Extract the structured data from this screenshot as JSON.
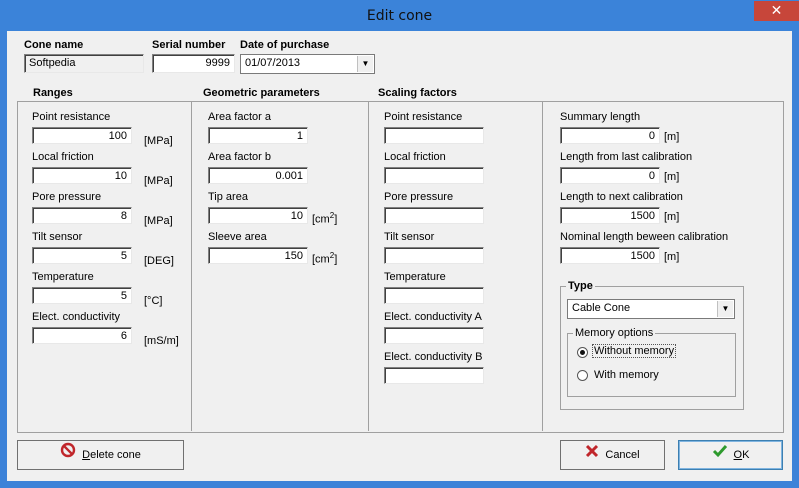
{
  "window": {
    "title": "Edit cone",
    "close_glyph": "✕"
  },
  "header": {
    "cone_name_label": "Cone name",
    "cone_name_value": "Softpedia",
    "serial_number_label": "Serial number",
    "serial_number_value": "9999",
    "date_of_purchase_label": "Date of purchase",
    "date_of_purchase_value": "01/07/2013"
  },
  "ranges": {
    "title": "Ranges",
    "items": [
      {
        "label": "Point resistance",
        "value": "100",
        "unit": "[MPa]"
      },
      {
        "label": "Local friction",
        "value": "10",
        "unit": "[MPa]"
      },
      {
        "label": "Pore pressure",
        "value": "8",
        "unit": "[MPa]"
      },
      {
        "label": "Tilt sensor",
        "value": "5",
        "unit": "[DEG]"
      },
      {
        "label": "Temperature",
        "value": "5",
        "unit": "[°C]"
      },
      {
        "label": "Elect. conductivity",
        "value": "6",
        "unit": "[mS/m]"
      }
    ]
  },
  "geometric": {
    "title": "Geometric parameters",
    "items": [
      {
        "label": "Area factor a",
        "value": "1",
        "unit": ""
      },
      {
        "label": "Area factor b",
        "value": "0.001",
        "unit": ""
      },
      {
        "label": "Tip area",
        "value": "10",
        "unit": "[cm",
        "unit_sup": "2",
        "unit_end": "]"
      },
      {
        "label": "Sleeve area",
        "value": "150",
        "unit": "[cm",
        "unit_sup": "2",
        "unit_end": "]"
      }
    ]
  },
  "scaling": {
    "title": "Scaling factors",
    "items": [
      {
        "label": "Point resistance",
        "value": ""
      },
      {
        "label": "Local friction",
        "value": ""
      },
      {
        "label": "Pore pressure",
        "value": ""
      },
      {
        "label": "Tilt sensor",
        "value": ""
      },
      {
        "label": "Temperature",
        "value": ""
      },
      {
        "label": "Elect. conductivity A",
        "value": ""
      },
      {
        "label": "Elect. conductivity B",
        "value": ""
      }
    ]
  },
  "lengths": {
    "items": [
      {
        "label": "Summary length",
        "value": "0",
        "unit": "[m]"
      },
      {
        "label": "Length from last calibration",
        "value": "0",
        "unit": "[m]"
      },
      {
        "label": "Length to next calibration",
        "value": "1500",
        "unit": "[m]"
      },
      {
        "label": "Nominal length beween calibration",
        "value": "1500",
        "unit": "[m]"
      }
    ]
  },
  "type": {
    "title": "Type",
    "selected": "Cable Cone",
    "memory_options_title": "Memory options",
    "option_without": "Without memory",
    "option_with": "With memory",
    "selected_option": "Without memory"
  },
  "buttons": {
    "delete_prefix": "",
    "delete_accel": "D",
    "delete_rest": "elete cone",
    "cancel": "Cancel",
    "ok_accel": "O",
    "ok_rest": "K"
  },
  "colors": {
    "titlebar": "#3b83d9",
    "close": "#c7463a",
    "client": "#f0f0f0",
    "cancel_icon": "#c0262b",
    "ok_icon": "#2e9a2e",
    "delete_icon": "#c0262b"
  }
}
